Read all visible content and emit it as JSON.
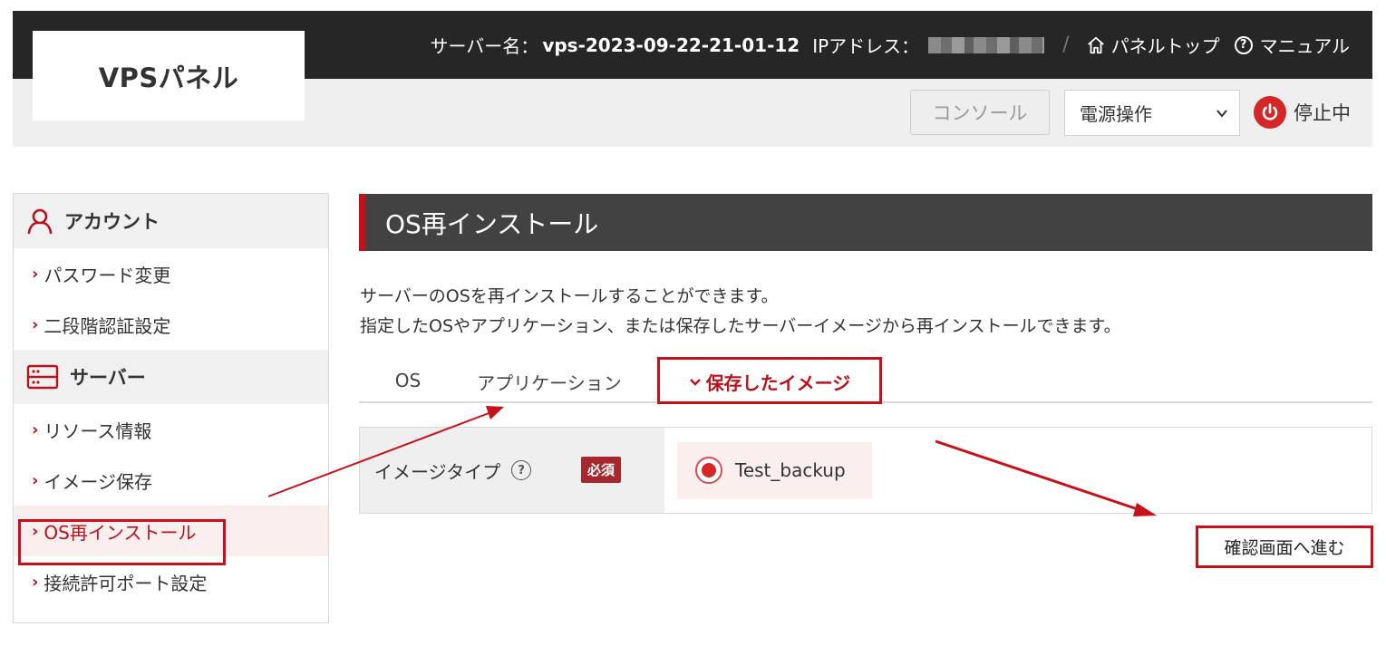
{
  "header": {
    "logo": "VPSパネル",
    "server_name_label": "サーバー名：",
    "server_name_value": "vps-2023-09-22-21-01-12",
    "ip_label": "IPアドレス：",
    "separator": "/",
    "panel_top_link": "パネルトップ",
    "manual_link": "マニュアル",
    "console_button": "コンソール",
    "power_select_value": "電源操作",
    "status_text": "停止中"
  },
  "sidebar": {
    "account_heading": "アカウント",
    "account_items": [
      {
        "label": "パスワード変更"
      },
      {
        "label": "二段階認証設定"
      }
    ],
    "server_heading": "サーバー",
    "server_items": [
      {
        "label": "リソース情報"
      },
      {
        "label": "イメージ保存"
      },
      {
        "label": "OS再インストール"
      },
      {
        "label": "接続許可ポート設定"
      }
    ]
  },
  "main": {
    "title": "OS再インストール",
    "description_line1": "サーバーのOSを再インストールすることができます。",
    "description_line2": "指定したOSやアプリケーション、または保存したサーバーイメージから再インストールできます。",
    "tabs": [
      {
        "label": "OS"
      },
      {
        "label": "アプリケーション"
      },
      {
        "label": "保存したイメージ"
      }
    ],
    "form": {
      "label": "イメージタイプ",
      "help_symbol": "?",
      "required_badge": "必須",
      "option_label": "Test_backup"
    },
    "confirm_button": "確認画面へ進む"
  },
  "colors": {
    "accent": "#c8101a",
    "header_bg": "#262626",
    "title_bg": "#424242"
  }
}
